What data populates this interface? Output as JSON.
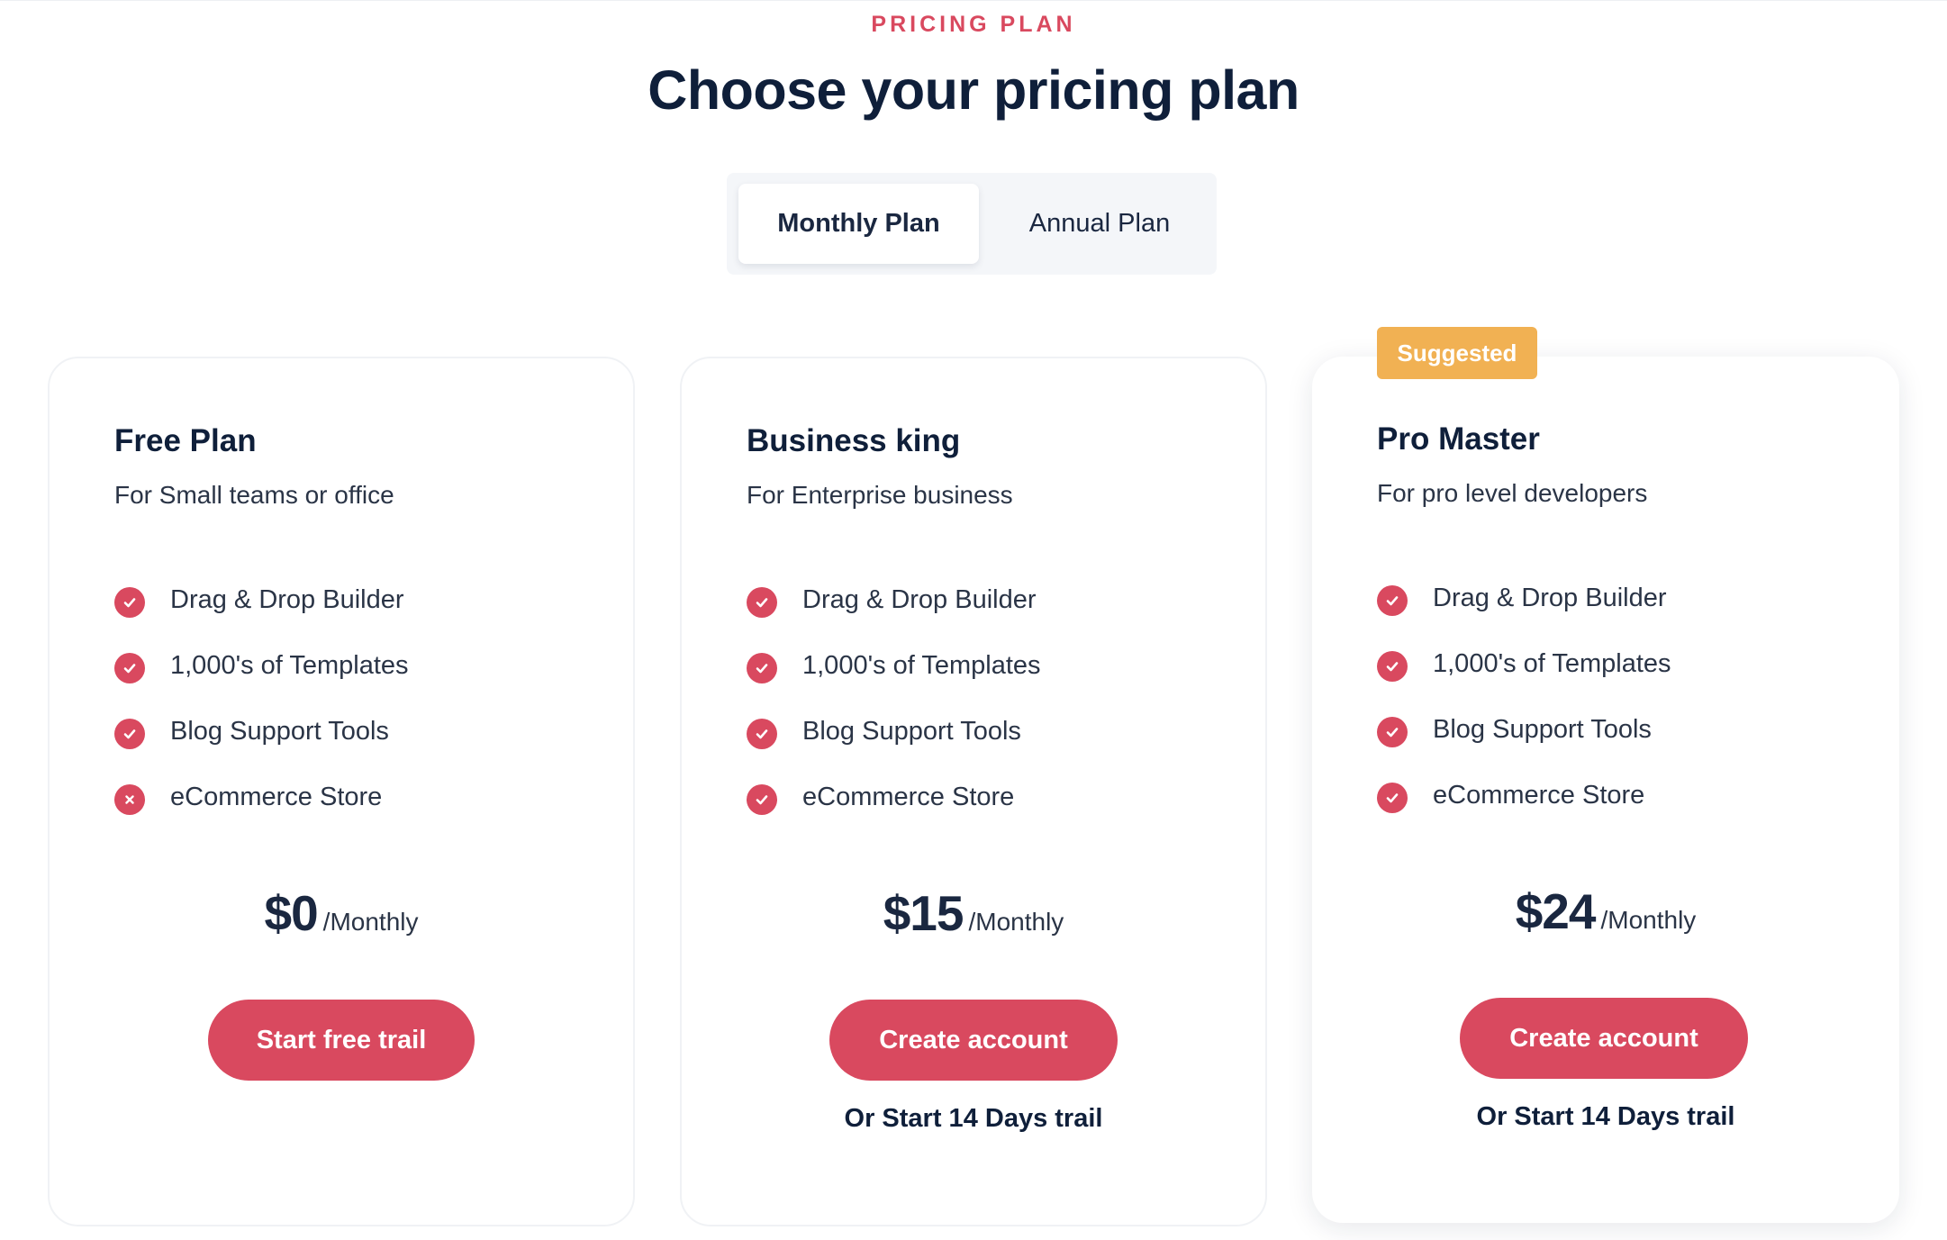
{
  "header": {
    "eyebrow": "PRICING PLAN",
    "title": "Choose your pricing plan"
  },
  "toggle": {
    "options": [
      "Monthly Plan",
      "Annual Plan"
    ],
    "selected": "Monthly Plan"
  },
  "colors": {
    "accent": "#d9495f",
    "badge": "#f1b153",
    "heading": "#0f1f3a",
    "body_text": "#2a3446",
    "toggle_bg": "#f4f6f9"
  },
  "plans": [
    {
      "name": "Free Plan",
      "subtitle": "For Small teams or office",
      "features": [
        {
          "label": "Drag & Drop Builder",
          "included": true,
          "icon": "check-icon"
        },
        {
          "label": "1,000's of Templates",
          "included": true,
          "icon": "check-icon"
        },
        {
          "label": "Blog Support Tools",
          "included": true,
          "icon": "check-icon"
        },
        {
          "label": "eCommerce Store",
          "included": false,
          "icon": "close-icon"
        }
      ],
      "price": "$0",
      "period": "/Monthly",
      "cta": "Start free trail"
    },
    {
      "name": "Business king",
      "subtitle": "For Enterprise business",
      "features": [
        {
          "label": "Drag & Drop Builder",
          "included": true,
          "icon": "check-icon"
        },
        {
          "label": "1,000's of Templates",
          "included": true,
          "icon": "check-icon"
        },
        {
          "label": "Blog Support Tools",
          "included": true,
          "icon": "check-icon"
        },
        {
          "label": "eCommerce Store",
          "included": true,
          "icon": "check-icon"
        }
      ],
      "price": "$15",
      "period": "/Monthly",
      "cta": "Create account",
      "trial_text": "Or Start 14 Days trail"
    },
    {
      "name": "Pro Master",
      "badge": "Suggested",
      "subtitle": "For pro level developers",
      "features": [
        {
          "label": "Drag & Drop Builder",
          "included": true,
          "icon": "check-icon"
        },
        {
          "label": "1,000's of Templates",
          "included": true,
          "icon": "check-icon"
        },
        {
          "label": "Blog Support Tools",
          "included": true,
          "icon": "check-icon"
        },
        {
          "label": "eCommerce Store",
          "included": true,
          "icon": "check-icon"
        }
      ],
      "price": "$24",
      "period": "/Monthly",
      "cta": "Create account",
      "trial_text": "Or Start 14 Days trail"
    }
  ]
}
